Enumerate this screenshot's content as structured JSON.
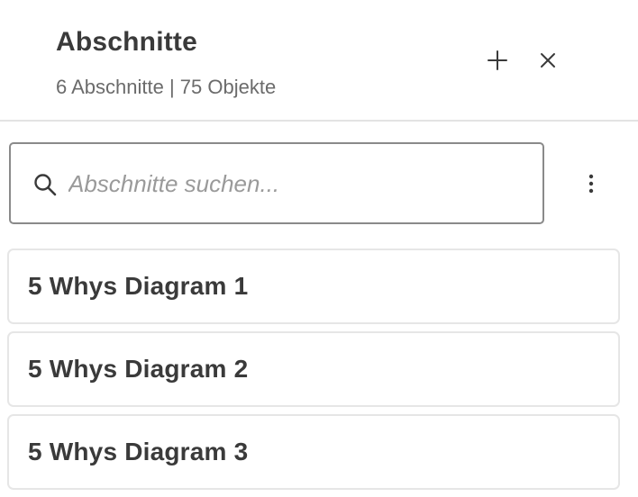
{
  "panel": {
    "title": "Abschnitte",
    "subtitle": "6 Abschnitte | 75 Objekte"
  },
  "actions": {
    "add_icon": "plus-icon",
    "close_icon": "close-icon",
    "more_icon": "vertical-ellipsis-icon"
  },
  "search": {
    "placeholder": "Abschnitte suchen...",
    "value": "",
    "icon": "search-icon"
  },
  "sections": [
    {
      "label": "5 Whys Diagram 1"
    },
    {
      "label": "5 Whys Diagram 2"
    },
    {
      "label": "5 Whys Diagram 3"
    }
  ],
  "colors": {
    "text": "#3a3a3a",
    "muted": "#6b6b6b",
    "border": "#e6e6e6",
    "input_border": "#8a8a8a"
  }
}
